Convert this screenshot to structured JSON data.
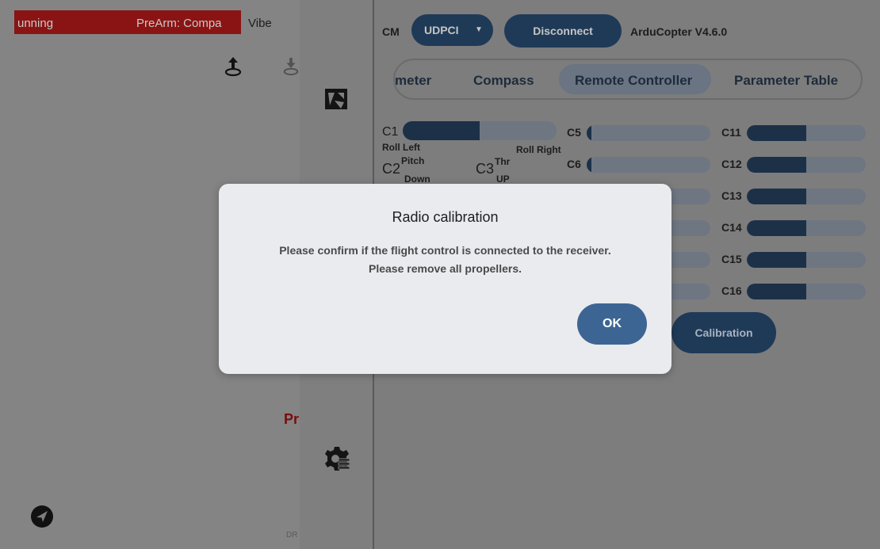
{
  "status_bar": {
    "state_text": "unning",
    "prearm_text": "PreArm: Compa",
    "vibe_text": "Vibe"
  },
  "left_panel": {
    "pr_text": "Pr",
    "dr_text": "DR"
  },
  "connection": {
    "com_label": "CM",
    "port_value": "UDPCI",
    "port_arrow": "▼",
    "disconnect_label": "Disconnect",
    "firmware": "ArduCopter V4.6.0"
  },
  "tabs": [
    {
      "label": "meter"
    },
    {
      "label": "Compass"
    },
    {
      "label": "Remote Controller",
      "active": true
    },
    {
      "label": "Parameter Table"
    }
  ],
  "channels": {
    "c1": {
      "label": "C1",
      "level": 0.5
    },
    "c5": {
      "label": "C5",
      "level": 0.04
    },
    "c6": {
      "label": "C6",
      "level": 0.04
    },
    "c11": {
      "label": "C11",
      "level": 0.5
    },
    "c12": {
      "label": "C12",
      "level": 0.5
    },
    "c13": {
      "label": "C13",
      "level": 0.5
    },
    "c14": {
      "label": "C14",
      "level": 0.5
    },
    "c15": {
      "label": "C15",
      "level": 0.5
    },
    "c16": {
      "label": "C16",
      "level": 0.5
    }
  },
  "stick_labels": {
    "roll_left": "Roll Left",
    "roll_right": "Roll Right",
    "c2": "C2",
    "pitch": "Pitch",
    "down": "Down",
    "c3": "C3",
    "thr": "Thr",
    "up": "UP"
  },
  "calibration_button": "Calibration",
  "dialog": {
    "title": "Radio calibration",
    "message_line1": "Please confirm if the flight control is connected to the receiver.",
    "message_line2": "Please remove all propellers.",
    "ok_label": "OK"
  },
  "icons": {
    "upload": "upload-icon",
    "download": "download-icon",
    "calibration_menu": "calibration-menu-icon",
    "settings_menu": "settings-gear-icon",
    "send": "send-icon"
  },
  "colors": {
    "accent": "#3d6593",
    "button_dark": "#1f3a57",
    "status_red": "#8a1414"
  }
}
